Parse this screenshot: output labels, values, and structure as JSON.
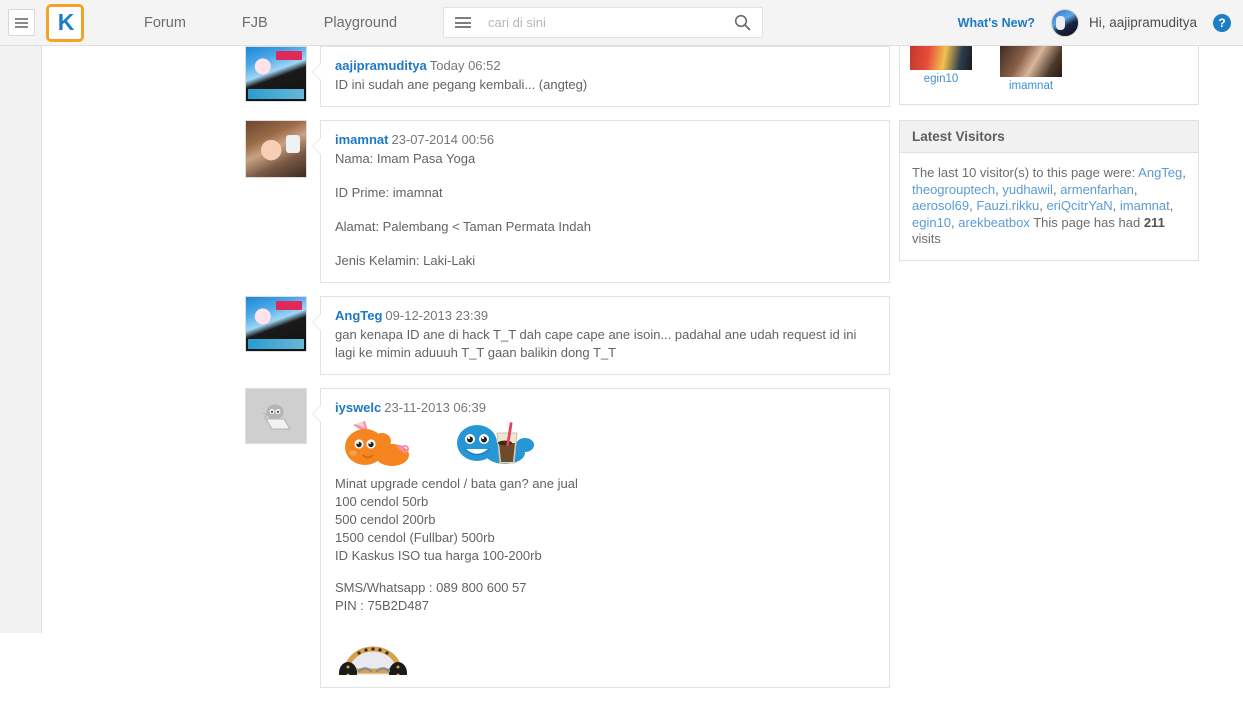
{
  "header": {
    "menu_button_icon": "hamburger-icon",
    "logo_letter": "K",
    "nav": [
      {
        "label": "Forum"
      },
      {
        "label": "FJB"
      },
      {
        "label": "Playground"
      }
    ],
    "search": {
      "category_icon": "hamburger-icon",
      "placeholder": "cari di sini",
      "value": "",
      "submit_icon": "search-icon"
    },
    "whats_new_label": "What's New?",
    "greeting": "Hi, aajipramuditya",
    "help_icon_glyph": "?",
    "accent_blue": "#1d78c6",
    "accent_orange": "#f4a326"
  },
  "posts": [
    {
      "avatar_style": "anime",
      "username": "aajipramuditya",
      "timestamp": "Today 06:52",
      "lines": [
        "ID ini sudah ane pegang kembali... (angteg)"
      ]
    },
    {
      "avatar_style": "girl",
      "username": "imamnat",
      "timestamp": "23-07-2014 00:56",
      "lines": [
        "Nama: Imam Pasa Yoga",
        "ID Prime: imamnat",
        "Alamat: Palembang < Taman Permata Indah",
        "Jenis Kelamin: Laki-Laki"
      ]
    },
    {
      "avatar_style": "anime",
      "username": "AngTeg",
      "timestamp": "09-12-2013 23:39",
      "lines": [
        "gan kenapa ID ane di hack T_T dah cape cape ane isoin... padahal ane udah request id ini lagi ke mimin aduuuh T_T gaan balikin dong T_T"
      ]
    },
    {
      "avatar_style": "none",
      "username": "iyswelc",
      "timestamp": "23-11-2013 06:39",
      "emoticons": [
        "bata-emoticon",
        "cendol-emoticon"
      ],
      "lines": [
        "Minat upgrade cendol / bata gan? ane jual",
        "100 cendol 50rb",
        "500 cendol 200rb",
        "1500 cendol (Fullbar) 500rb",
        "ID Kaskus ISO tua harga 100-200rb"
      ],
      "contact_lines": [
        "SMS/Whatsapp : 089 800 600 57",
        "PIN : 75B2D487"
      ],
      "trailing_emoticon": "mask-emoticon"
    }
  ],
  "sidebar": {
    "visitor_thumbs": [
      {
        "name": "egin10"
      },
      {
        "name": "imamnat"
      }
    ],
    "latest_visitors": {
      "title": "Latest Visitors",
      "intro": "The last 10 visitor(s) to this page were:",
      "visitors": [
        "AngTeg",
        "theogrouptech",
        "yudhawil",
        "armenfarhan",
        "aerosol69",
        "Fauzi.rikku",
        "eriQcitrYaN",
        "imamnat",
        "egin10",
        "arekbeatbox"
      ],
      "visits_prefix": "This page has had",
      "visits_count": "211",
      "visits_suffix": "visits"
    }
  }
}
